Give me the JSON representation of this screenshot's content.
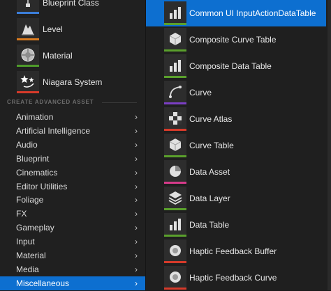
{
  "quick_items": [
    {
      "label": "Blueprint Class",
      "icon": "blueprint-class-icon",
      "bar": "#3b7dd8"
    },
    {
      "label": "Level",
      "icon": "level-icon",
      "bar": "#d97b1f"
    },
    {
      "label": "Material",
      "icon": "material-icon",
      "bar": "#4e9a2a"
    },
    {
      "label": "Niagara System",
      "icon": "niagara-system-icon",
      "bar": "#d63a2a"
    }
  ],
  "section_header": "CREATE ADVANCED ASSET",
  "categories": [
    {
      "label": "Animation"
    },
    {
      "label": "Artificial Intelligence"
    },
    {
      "label": "Audio"
    },
    {
      "label": "Blueprint"
    },
    {
      "label": "Cinematics"
    },
    {
      "label": "Editor Utilities"
    },
    {
      "label": "Foliage"
    },
    {
      "label": "FX"
    },
    {
      "label": "Gameplay"
    },
    {
      "label": "Input"
    },
    {
      "label": "Material"
    },
    {
      "label": "Media"
    },
    {
      "label": "Miscellaneous",
      "selected": true
    }
  ],
  "assets": [
    {
      "label": "Common UI InputActionDataTable",
      "icon": "data-table-icon",
      "bar": "#5aa02c",
      "selected": true
    },
    {
      "label": "Composite Curve Table",
      "icon": "curve-table-icon",
      "bar": "#5aa02c"
    },
    {
      "label": "Composite Data Table",
      "icon": "data-table-icon",
      "bar": "#5aa02c"
    },
    {
      "label": "Curve",
      "icon": "curve-icon",
      "bar": "#7b3fc4"
    },
    {
      "label": "Curve Atlas",
      "icon": "curve-atlas-icon",
      "bar": "#d63a2a"
    },
    {
      "label": "Curve Table",
      "icon": "curve-table-icon",
      "bar": "#5aa02c"
    },
    {
      "label": "Data Asset",
      "icon": "data-asset-icon",
      "bar": "#d63a8a"
    },
    {
      "label": "Data Layer",
      "icon": "data-layer-icon",
      "bar": "#5aa02c"
    },
    {
      "label": "Data Table",
      "icon": "data-table-icon",
      "bar": "#5aa02c"
    },
    {
      "label": "Haptic Feedback Buffer",
      "icon": "haptic-feedback-icon",
      "bar": "#d63a2a"
    },
    {
      "label": "Haptic Feedback Curve",
      "icon": "haptic-feedback-icon",
      "bar": "#d63a2a"
    }
  ],
  "colors": {
    "accent": "#0d6fd0"
  }
}
